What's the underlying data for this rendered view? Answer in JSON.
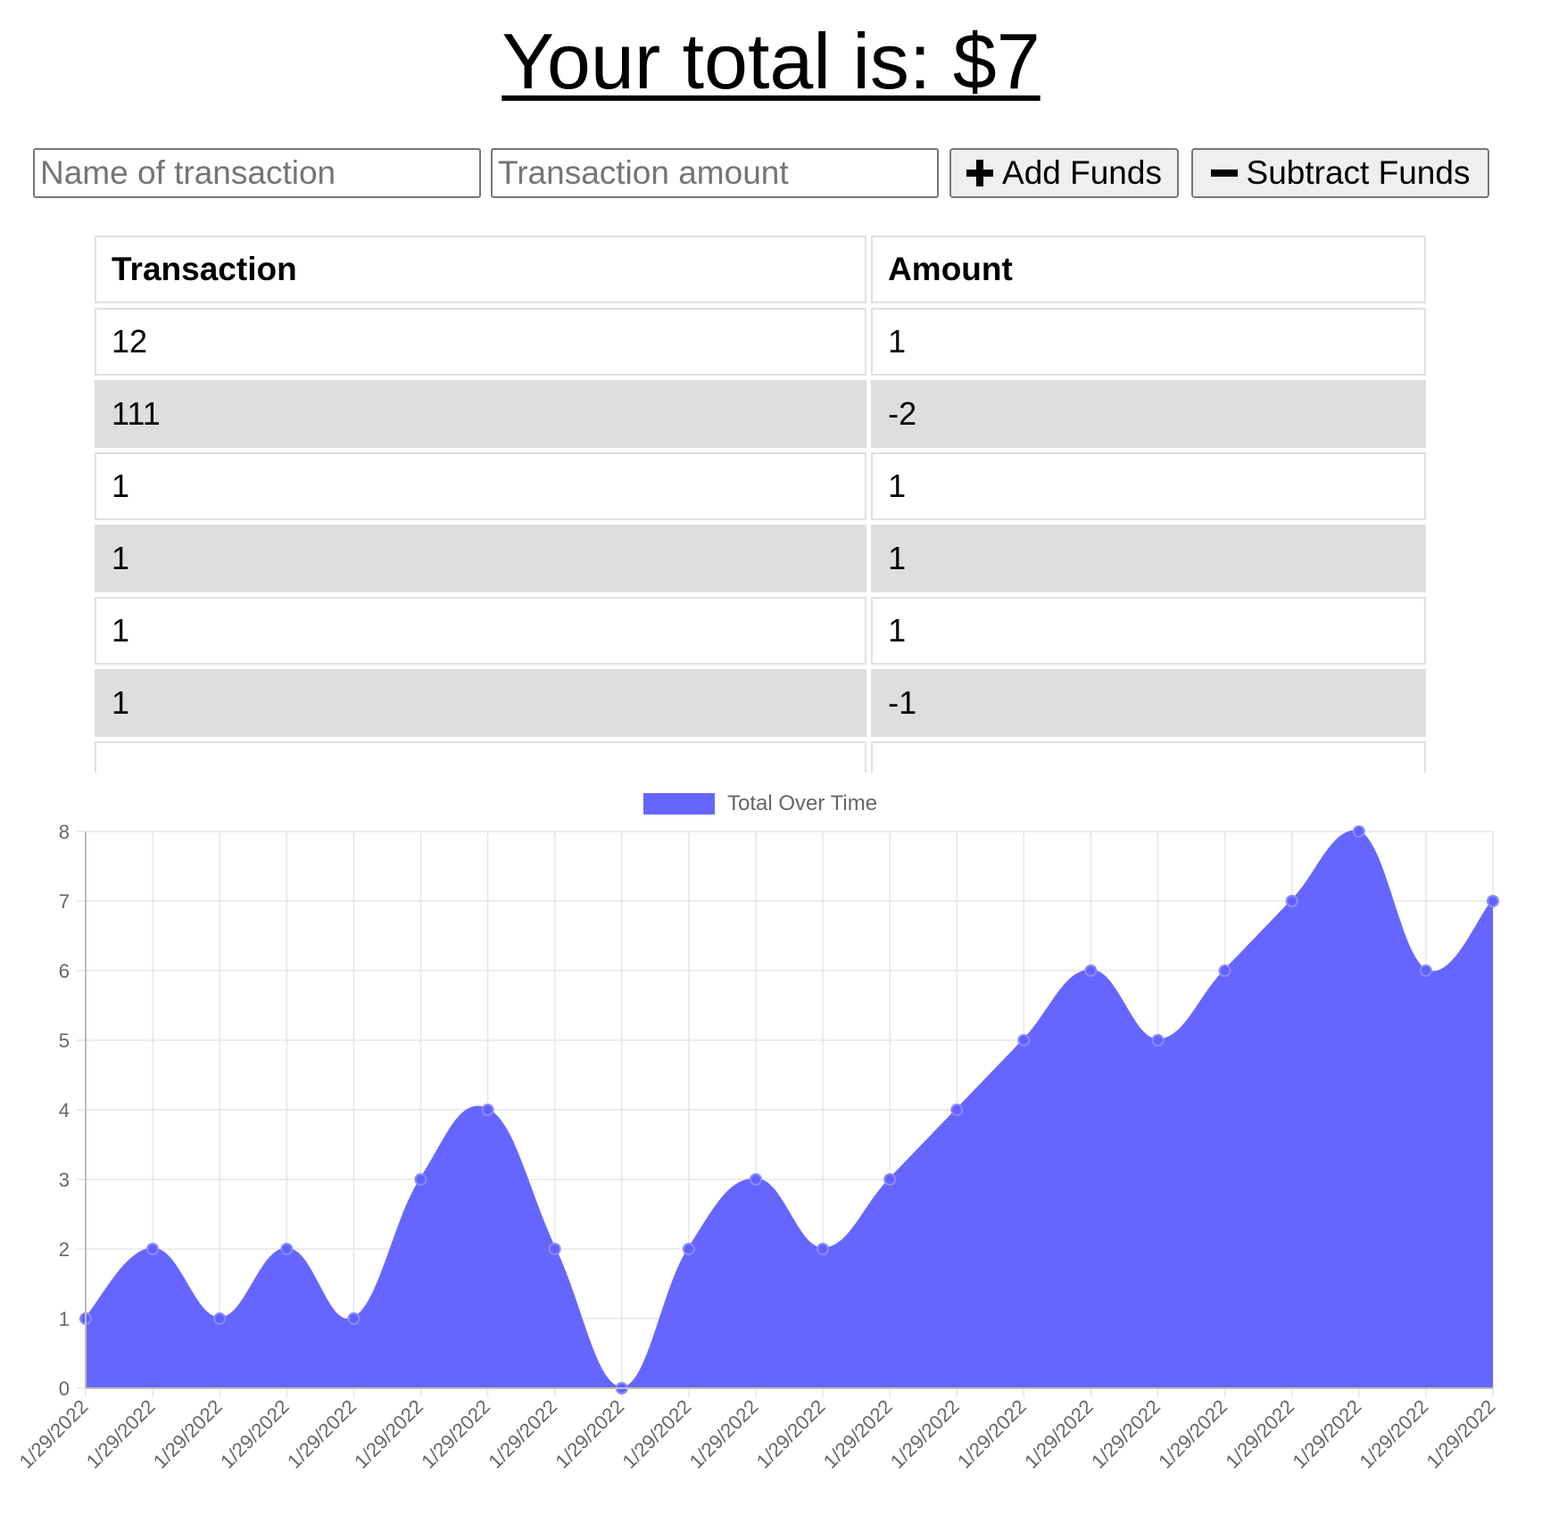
{
  "header": {
    "title": "Your total is: $7"
  },
  "form": {
    "name_placeholder": "Name of transaction",
    "amount_placeholder": "Transaction amount",
    "add_label": "Add Funds",
    "subtract_label": "Subtract Funds"
  },
  "table": {
    "headers": [
      "Transaction",
      "Amount"
    ],
    "rows": [
      [
        "12",
        "1"
      ],
      [
        "111",
        "-2"
      ],
      [
        "1",
        "1"
      ],
      [
        "1",
        "1"
      ],
      [
        "1",
        "1"
      ],
      [
        "1",
        "-1"
      ],
      [
        "",
        ""
      ]
    ]
  },
  "colors": {
    "area_fill": "#6666ff",
    "point": "#6161ff",
    "grid": "#e6e6e6"
  },
  "chart_data": {
    "type": "area",
    "legend": "Total Over Time",
    "legend_position": "top",
    "grid": true,
    "x": [
      "1/29/2022",
      "1/29/2022",
      "1/29/2022",
      "1/29/2022",
      "1/29/2022",
      "1/29/2022",
      "1/29/2022",
      "1/29/2022",
      "1/29/2022",
      "1/29/2022",
      "1/29/2022",
      "1/29/2022",
      "1/29/2022",
      "1/29/2022",
      "1/29/2022",
      "1/29/2022",
      "1/29/2022",
      "1/29/2022",
      "1/29/2022",
      "1/29/2022",
      "1/29/2022",
      "1/29/2022"
    ],
    "series": [
      {
        "name": "Total Over Time",
        "values": [
          1,
          2,
          1,
          2,
          1,
          3,
          4,
          2,
          0,
          2,
          3,
          2,
          3,
          4,
          5,
          6,
          5,
          6,
          7,
          8,
          6,
          7
        ]
      }
    ],
    "ylim": [
      0,
      8
    ],
    "yticks": [
      0,
      1,
      2,
      3,
      4,
      5,
      6,
      7,
      8
    ]
  }
}
